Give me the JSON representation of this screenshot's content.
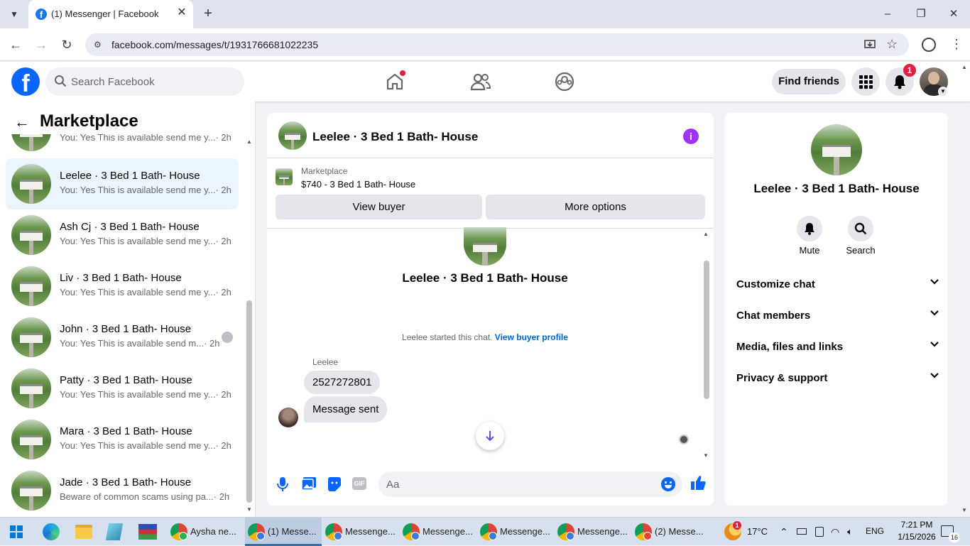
{
  "browser": {
    "tab_title": "(1) Messenger | Facebook",
    "url": "facebook.com/messages/t/1931766681022235"
  },
  "fb_header": {
    "search_placeholder": "Search Facebook",
    "find_friends": "Find friends",
    "notification_count": "1"
  },
  "sidebar": {
    "title": "Marketplace",
    "conversations": [
      {
        "name": "",
        "preview": "You: Yes This is available send me y...",
        "time": "· 2h",
        "active": false
      },
      {
        "name": "Leelee · 3 Bed 1 Bath- House",
        "preview": "You: Yes This is available send me y...",
        "time": "· 2h",
        "active": true
      },
      {
        "name": "Ash Cj · 3 Bed 1 Bath- House",
        "preview": "You: Yes This is available send me y...",
        "time": "· 2h",
        "active": false
      },
      {
        "name": "Liv · 3 Bed 1 Bath- House",
        "preview": "You: Yes This is available send me y...",
        "time": "· 2h",
        "active": false
      },
      {
        "name": "John · 3 Bed 1 Bath- House",
        "preview": "You: Yes This is available send m...",
        "time": "· 2h",
        "active": false
      },
      {
        "name": "Patty · 3 Bed 1 Bath- House",
        "preview": "You: Yes This is available send me y...",
        "time": "· 2h",
        "active": false
      },
      {
        "name": "Mara · 3 Bed 1 Bath- House",
        "preview": "You: Yes This is available send me y...",
        "time": "· 2h",
        "active": false
      },
      {
        "name": "Jade · 3 Bed 1 Bath- House",
        "preview": "Beware of common scams using pa...",
        "time": "· 2h",
        "active": false
      }
    ]
  },
  "chat": {
    "title": "Leelee · 3 Bed 1 Bath- House",
    "marketplace_label": "Marketplace",
    "listing": "$740 - 3 Bed 1 Bath- House",
    "view_buyer": "View buyer",
    "more_options": "More options",
    "profile_name": "Leelee · 3 Bed 1 Bath- House",
    "started_text": "Leelee started this chat.",
    "view_profile_link": "View buyer profile",
    "sender": "Leelee",
    "messages": [
      "2527272801",
      "Message sent"
    ],
    "input_placeholder": "Aa"
  },
  "details": {
    "name": "Leelee · 3 Bed 1 Bath- House",
    "mute": "Mute",
    "search": "Search",
    "sections": [
      "Customize chat",
      "Chat members",
      "Media, files and links",
      "Privacy & support"
    ]
  },
  "taskbar": {
    "items": [
      "Aysha ne...",
      "(1) Messe...",
      "Messenge...",
      "Messenge...",
      "Messenge...",
      "Messenge...",
      "(2) Messe..."
    ],
    "weather": "17°C",
    "lang": "ENG",
    "time": "7:21 PM",
    "date": "1/15/2026",
    "weather_badge": "1",
    "notif_count": "16"
  },
  "colors": {
    "fb_blue": "#0866ff",
    "messenger_accent": "#a033ff",
    "link": "#0064d1"
  }
}
